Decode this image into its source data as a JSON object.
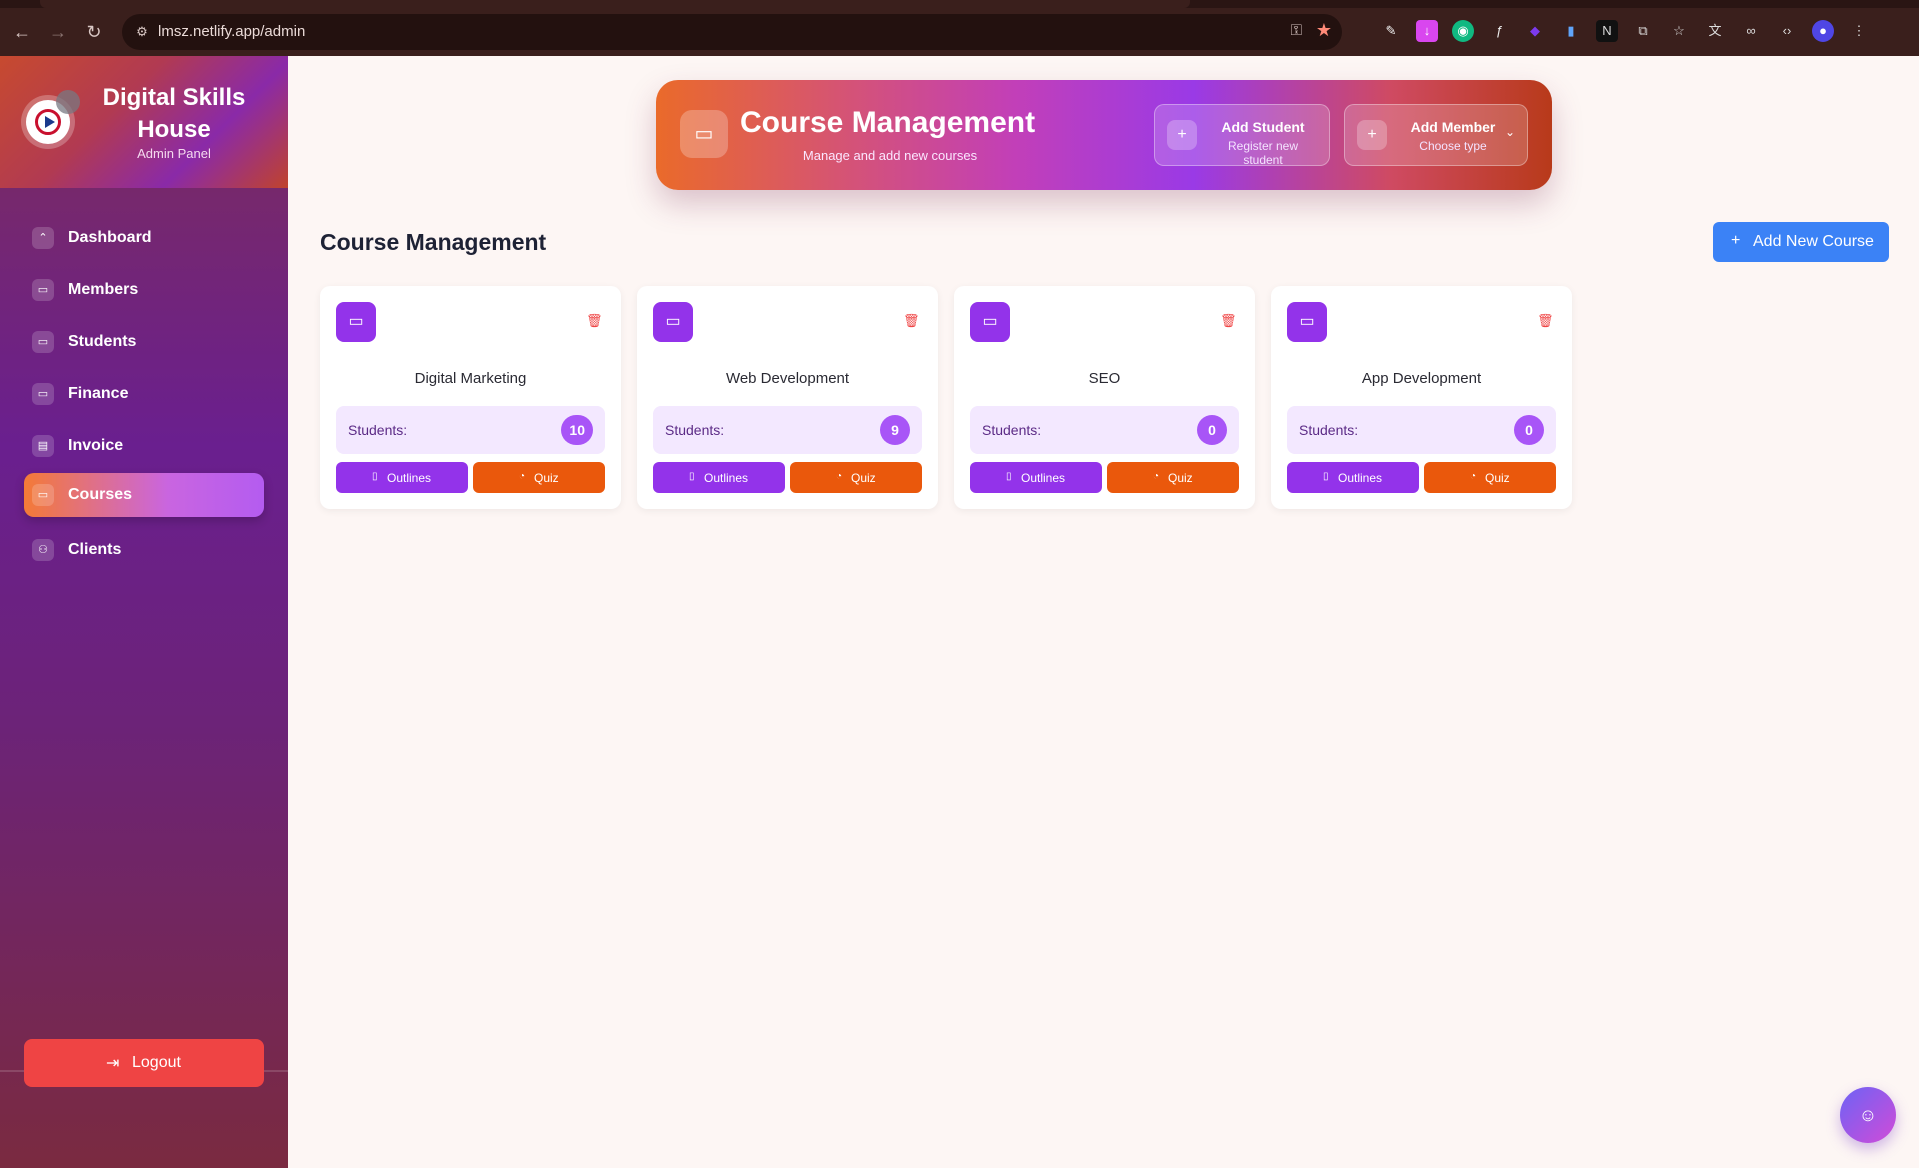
{
  "browser": {
    "url": "lmsz.netlify.app/admin",
    "back": "←",
    "forward": "→",
    "reload": "↻",
    "site_info": "⚙",
    "key": "⚿",
    "star": "★"
  },
  "sidebar": {
    "brand_name": "Digital Skills House",
    "brand_sub": "Admin Panel",
    "items": [
      {
        "label": "Dashboard",
        "glyph": "⌃"
      },
      {
        "label": "Members",
        "glyph": "▭"
      },
      {
        "label": "Students",
        "glyph": "▭"
      },
      {
        "label": "Finance",
        "glyph": "▭"
      },
      {
        "label": "Invoice",
        "glyph": "▤"
      },
      {
        "label": "Courses",
        "glyph": "▭"
      },
      {
        "label": "Clients",
        "glyph": "⚇"
      }
    ],
    "active": "Courses",
    "logout_label": "Logout",
    "logout_glyph": "⇥"
  },
  "header": {
    "title": "Course Management",
    "subtitle": "Manage and add new courses",
    "icon_glyph": "▭",
    "add_student": {
      "title": "Add Student",
      "sub": "Register new student",
      "plus": "+"
    },
    "add_member": {
      "title": "Add Member",
      "sub": "Choose type",
      "plus": "+",
      "chevron": "⌄"
    }
  },
  "main": {
    "section_title": "Course Management",
    "add_course_label": "Add New Course",
    "add_course_plus": "+",
    "students_label": "Students:",
    "outlines_label": "Outlines",
    "quiz_label": "Quiz",
    "outlines_glyph": "▯",
    "quiz_glyph": "◔",
    "card_glyph": "▭",
    "trash_glyph": "🗑",
    "courses": [
      {
        "name": "Digital Marketing",
        "students": "10"
      },
      {
        "name": "Web Development",
        "students": "9"
      },
      {
        "name": "SEO",
        "students": "0"
      },
      {
        "name": "App Development",
        "students": "0"
      }
    ]
  },
  "chat_glyph": "☺",
  "colors": {
    "accent_purple": "#9333ea",
    "accent_orange": "#ea580c",
    "primary_blue": "#3b82f6",
    "danger_red": "#ef4444"
  }
}
